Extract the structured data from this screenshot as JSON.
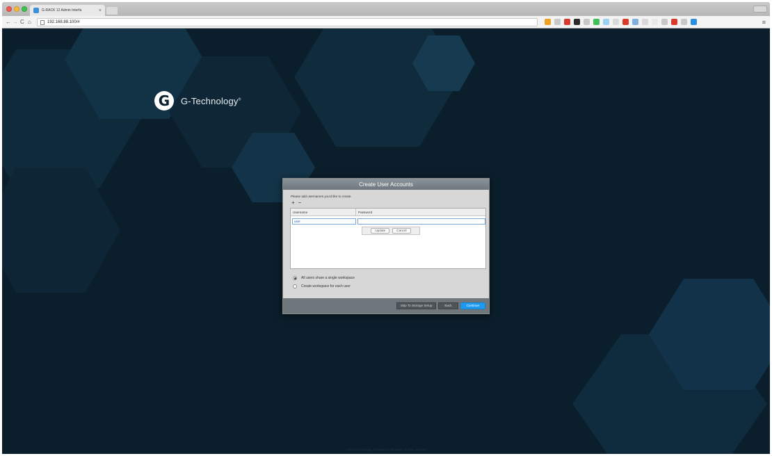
{
  "browser": {
    "tab_title": "G-RACK 12 Admin Interfa",
    "tab_close": "×",
    "url": "192.168.88.100/#",
    "nav": {
      "back": "←",
      "forward": "→",
      "reload": "C",
      "home": "⌂"
    },
    "menu": "≡",
    "extension_colors": [
      "#f0a020",
      "#c8c8c8",
      "#d93a2b",
      "#2b2b2b",
      "#c8c8c8",
      "#3fbf5a",
      "#9ad0f0",
      "#d9d9d9",
      "#d93a2b",
      "#7fb0e0",
      "#d9d9d9",
      "#e8e8e8",
      "#c8c8c8",
      "#d93a2b",
      "#c8c8c8",
      "#2a8fe0"
    ]
  },
  "brand": {
    "logo_letter": "G",
    "name": "G-Technology",
    "trademark": "®"
  },
  "dialog": {
    "title": "Create User Accounts",
    "instruction": "Please add usernames you'd like to create.",
    "add_label": "+",
    "remove_label": "−",
    "table": {
      "columns": [
        "Username",
        "Password"
      ],
      "username_value": "user",
      "password_value": ""
    },
    "row_actions": {
      "update": "Update",
      "cancel": "Cancel"
    },
    "options": [
      {
        "label": "All users share a single workspace",
        "checked": true
      },
      {
        "label": "Create workspace for each user",
        "checked": false
      }
    ],
    "buttons": {
      "skip": "Skip To Storage Setup",
      "back": "Back",
      "continue": "Continue"
    }
  },
  "footer": {
    "text": "©2016 G-Technology. A Western Digital brand. All rights reserved."
  },
  "colors": {
    "background": "#0b1e2b",
    "primary_button": "#1e9bf0",
    "dialog_header": "#7a848a"
  }
}
